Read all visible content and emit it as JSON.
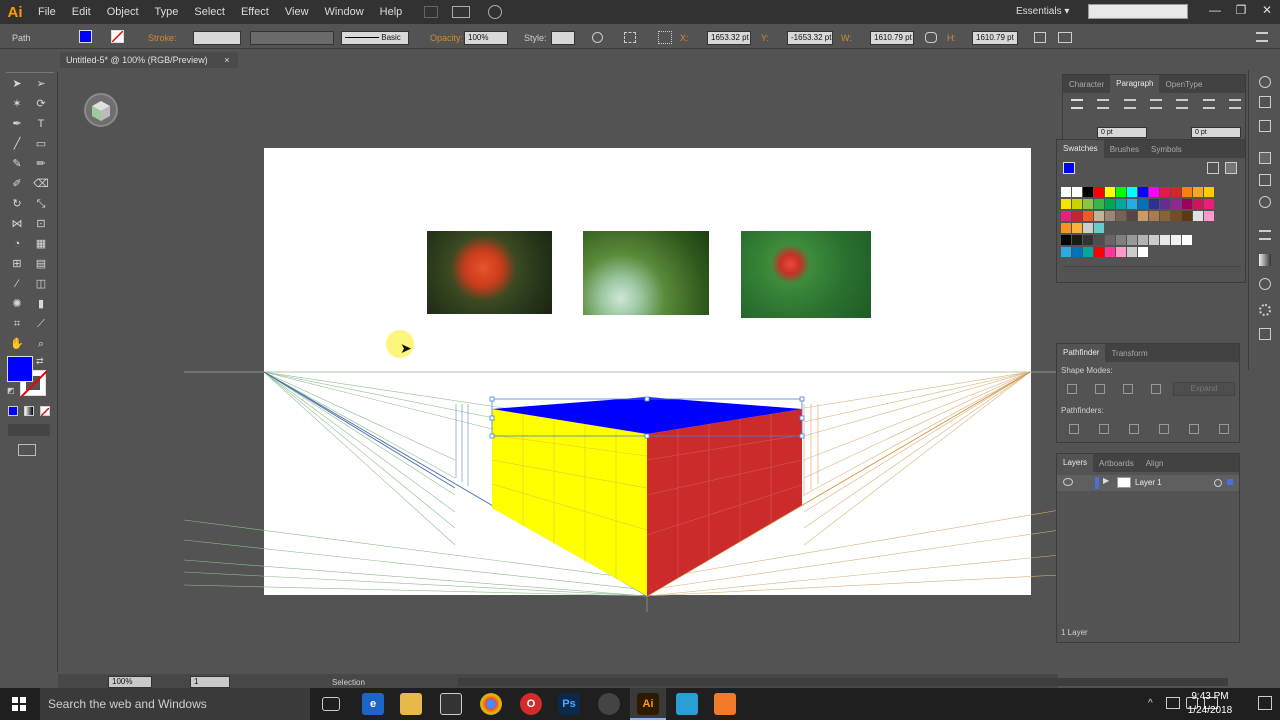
{
  "app": {
    "logo": "Ai"
  },
  "menu": [
    "File",
    "Edit",
    "Object",
    "Type",
    "Select",
    "Effect",
    "View",
    "Window",
    "Help"
  ],
  "workspace": {
    "label": "Essentials"
  },
  "window_controls": {
    "minimize": "—",
    "restore": "❐",
    "close": "✕"
  },
  "control_bar": {
    "selection_type": "Path",
    "stroke_label": "Stroke:",
    "brush": "Basic",
    "opacity_label": "Opacity:",
    "opacity": "100%",
    "style_label": "Style:",
    "x_label": "X:",
    "x": "1653.32 pt",
    "y_label": "Y:",
    "y": "-1653.32 pt",
    "w_label": "W:",
    "w": "1610.79 pt",
    "h_label": "H:",
    "h": "1610.79 pt"
  },
  "document": {
    "tab_title": "Untitled-5* @ 100% (RGB/Preview)",
    "close": "×"
  },
  "colors": {
    "fill": "#0000ff",
    "top_face": "#0000ff",
    "left_face": "#ffff00",
    "right_face": "#cc2b2b",
    "accent_orange": "#d28a2e"
  },
  "panels": {
    "type_tabs": [
      "Character",
      "Paragraph",
      "OpenType"
    ],
    "indent_left": "0 pt",
    "indent_right": "0 pt",
    "swatch_tabs": [
      "Swatches",
      "Brushes",
      "Symbols"
    ],
    "pathfinder_tabs": [
      "Pathfinder",
      "Transform"
    ],
    "shape_modes_label": "Shape Modes:",
    "expand_label": "Expand",
    "pathfinders_label": "Pathfinders:",
    "layers_tabs": [
      "Layers",
      "Artboards",
      "Align"
    ],
    "layer_name": "Layer 1",
    "layer_count": "1 Layer"
  },
  "status_bar": {
    "zoom": "100%",
    "artboard": "1",
    "tool": "Selection"
  },
  "taskbar": {
    "search_placeholder": "Search the web and Windows",
    "time": "9:43 PM",
    "date": "1/24/2018",
    "apps": [
      "Ps",
      "Ai"
    ]
  }
}
